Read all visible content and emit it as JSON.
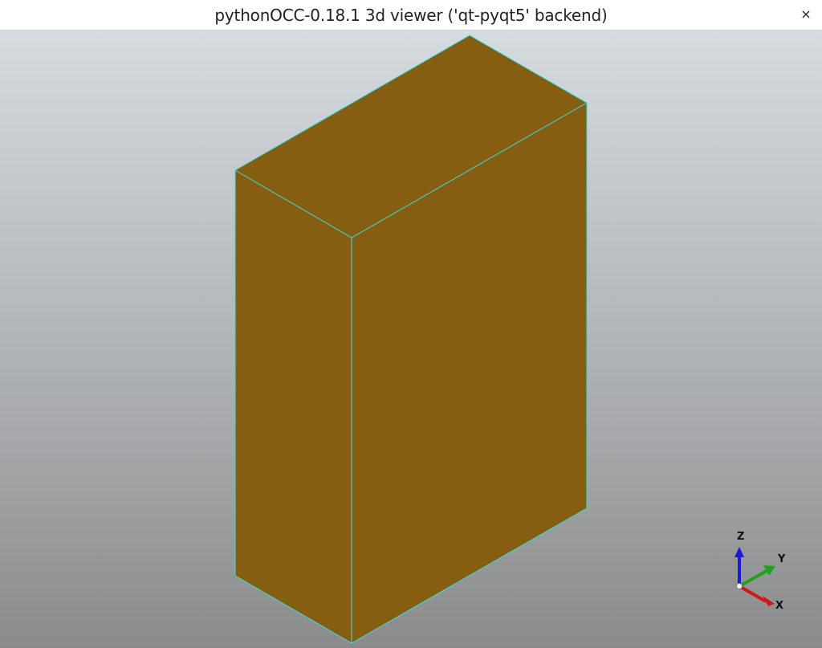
{
  "window": {
    "title": "pythonOCC-0.18.1 3d viewer ('qt-pyqt5' backend)",
    "close_glyph": "×"
  },
  "viewer": {
    "background_top_color": "#d6dbe0",
    "background_bottom_color": "#8b8b8b",
    "shape": {
      "type": "box",
      "face_color": "#865e12",
      "edge_color": "#34e0e0"
    },
    "trihedron": {
      "x_label": "X",
      "y_label": "Y",
      "z_label": "Z",
      "x_color": "#d01818",
      "y_color": "#20a020",
      "z_color": "#1a1ad8"
    }
  }
}
